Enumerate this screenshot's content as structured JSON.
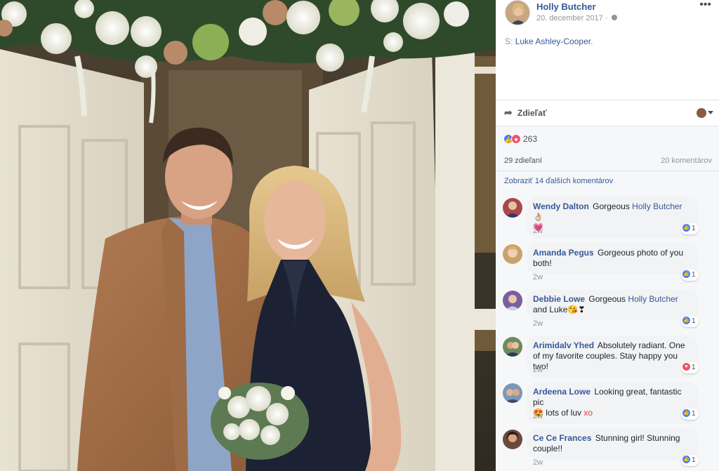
{
  "post": {
    "author": "Holly Butcher",
    "date": "20. december 2017 ·",
    "caption_prefix": "S:",
    "caption_link": "Luke Ashley-Cooper",
    "caption_suffix": "."
  },
  "actions": {
    "share_label": "Zdieľať"
  },
  "reactions": {
    "count": "263",
    "shares": "29 zdieľaní",
    "comments": "20 komentárov",
    "more_comments": "Zobraziť 14 ďalších komentárov"
  },
  "comments": [
    {
      "name": "Wendy Dalton",
      "text": "Gorgeous",
      "link": "Holly Butcher",
      "emoji": "👌🏼",
      "line2": "💗",
      "time": "2w",
      "likes": "1",
      "reaction": "like",
      "avatar": "#a9484b"
    },
    {
      "name": "Amanda Pegus",
      "text": "Gorgeous photo of you both!",
      "time": "2w",
      "likes": "1",
      "reaction": "like",
      "avatar": "#c9a16e"
    },
    {
      "name": "Debbie Lowe",
      "text": "Gorgeous",
      "link": "Holly Butcher",
      "after_link": "and Luke",
      "emoji": "😘❣",
      "time": "2w",
      "likes": "1",
      "reaction": "like",
      "avatar": "#7b5ea0"
    },
    {
      "name": "Arimidalv Yhed",
      "text": "Absolutely radiant. One of my favorite couples. Stay happy you two!",
      "time": "2w",
      "likes": "1",
      "reaction": "love",
      "avatar": "#6e8a5c"
    },
    {
      "name": "Ardeena Lowe",
      "text": "Looking great, fantastic pic",
      "text2": "lots of luv",
      "red": "xo",
      "emoji": "😍",
      "time": "2w",
      "likes": "1",
      "reaction": "like",
      "avatar": "#7a97b8"
    },
    {
      "name": "Ce Ce Frances",
      "text": "Stunning girl! Stunning couple!!",
      "time": "2w",
      "likes": "1",
      "reaction": "like",
      "avatar": "#6b4a3c"
    }
  ],
  "colors": {
    "link": "#365899",
    "like": "#4080ff",
    "love": "#f25268"
  }
}
